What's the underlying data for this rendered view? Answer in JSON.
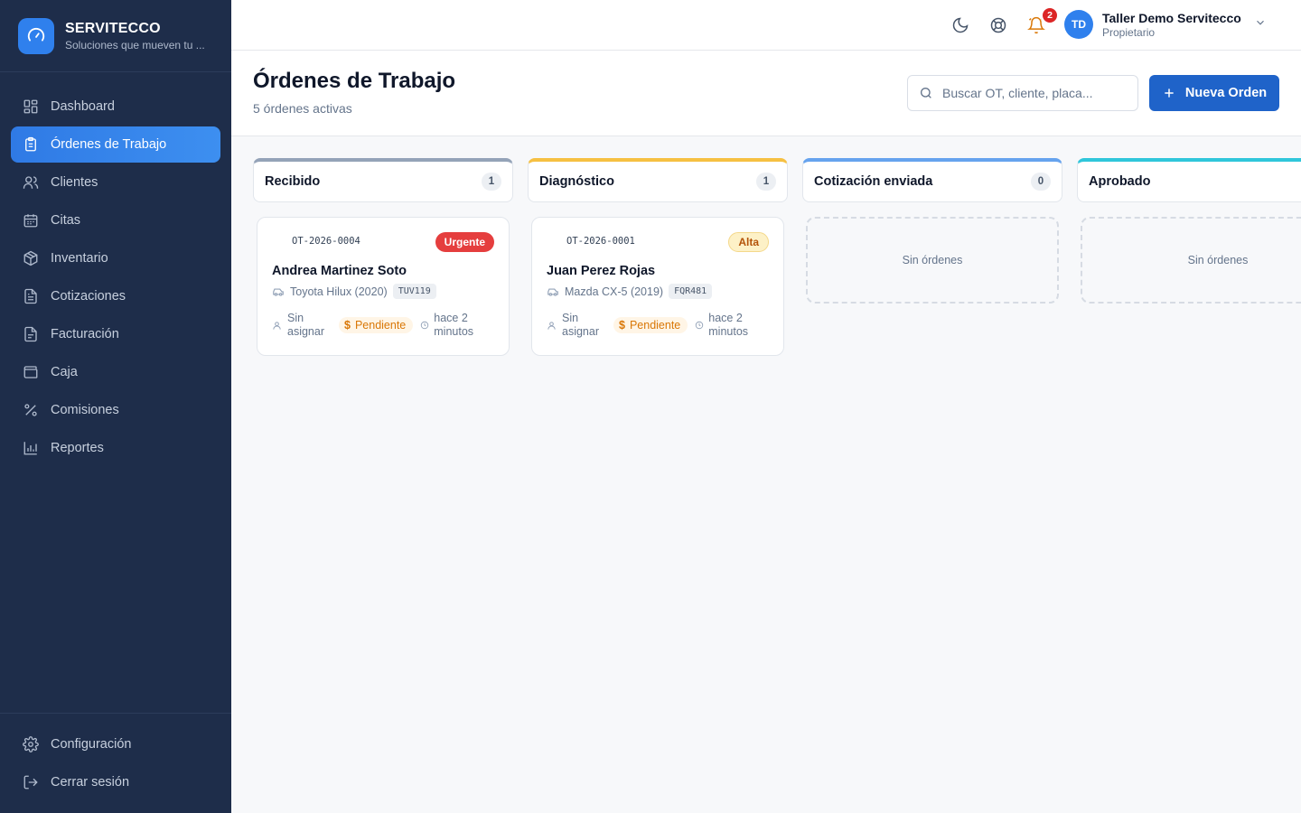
{
  "brand": {
    "name": "SERVITECCO",
    "tagline": "Soluciones que mueven tu ..."
  },
  "sidebar": {
    "items": [
      {
        "label": "Dashboard",
        "icon": "dashboard-icon"
      },
      {
        "label": "Órdenes de Trabajo",
        "icon": "clipboard-icon",
        "active": true
      },
      {
        "label": "Clientes",
        "icon": "users-icon"
      },
      {
        "label": "Citas",
        "icon": "calendar-icon"
      },
      {
        "label": "Inventario",
        "icon": "package-icon"
      },
      {
        "label": "Cotizaciones",
        "icon": "document-icon"
      },
      {
        "label": "Facturación",
        "icon": "invoice-icon"
      },
      {
        "label": "Caja",
        "icon": "wallet-icon"
      },
      {
        "label": "Comisiones",
        "icon": "percent-icon"
      },
      {
        "label": "Reportes",
        "icon": "bar-chart-icon"
      }
    ],
    "bottom": [
      {
        "label": "Configuración",
        "icon": "gear-icon"
      },
      {
        "label": "Cerrar sesión",
        "icon": "logout-icon"
      }
    ]
  },
  "topbar": {
    "notifications_count": "2",
    "user": {
      "initials": "TD",
      "name": "Taller Demo Servitecco",
      "role": "Propietario"
    }
  },
  "header": {
    "title": "Órdenes de Trabajo",
    "subtitle": "5 órdenes activas",
    "search_placeholder": "Buscar OT, cliente, placa...",
    "new_button": "Nueva Orden"
  },
  "columns": [
    {
      "title": "Recibido",
      "count": "1",
      "color": "#94a3b8",
      "cards": [
        {
          "code": "OT-2026-0004",
          "priority": "Urgente",
          "client": "Andrea Martinez Soto",
          "vehicle": "Toyota Hilux (2020)",
          "plate": "TUV119",
          "assigned": "Sin asignar",
          "payment": "Pendiente",
          "time": "hace 2 minutos"
        }
      ]
    },
    {
      "title": "Diagnóstico",
      "count": "1",
      "color": "#f6c042",
      "cards": [
        {
          "code": "OT-2026-0001",
          "priority": "Alta",
          "client": "Juan Perez Rojas",
          "vehicle": "Mazda CX-5 (2019)",
          "plate": "FQR481",
          "assigned": "Sin asignar",
          "payment": "Pendiente",
          "time": "hace 2 minutos"
        }
      ]
    },
    {
      "title": "Cotización enviada",
      "count": "0",
      "color": "#66a3ee",
      "empty_text": "Sin órdenes"
    },
    {
      "title": "Aprobado",
      "count": "",
      "color": "#2fc6da",
      "empty_text": "Sin órdenes"
    }
  ],
  "colors": {
    "sidebar_bg": "#1e2d4a",
    "accent": "#2f80ed",
    "primary_button": "#1f63c9",
    "urgent": "#e53e3e",
    "pending": "#d97706"
  }
}
